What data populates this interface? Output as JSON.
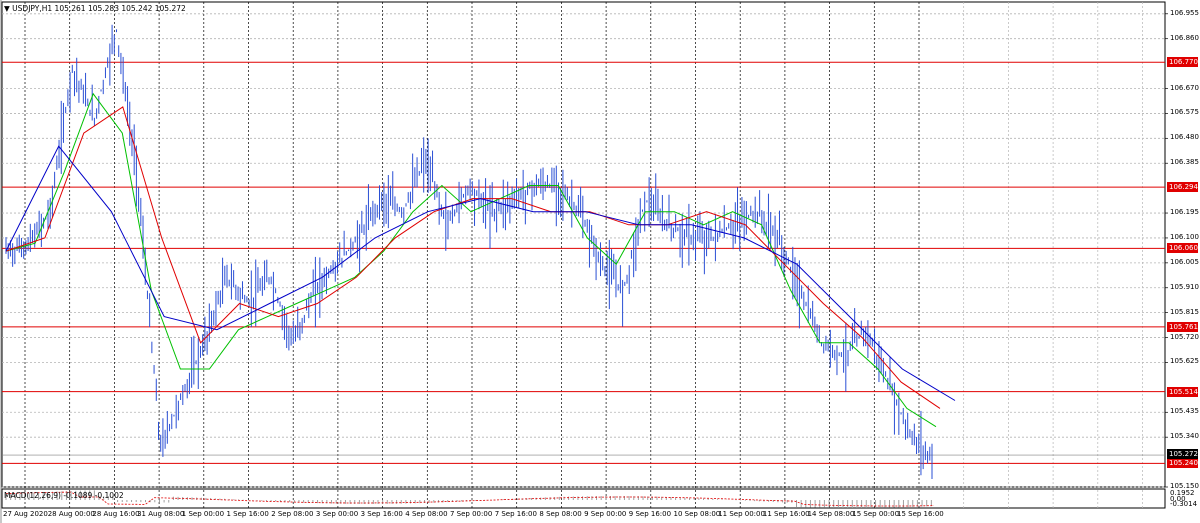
{
  "symbol_line": {
    "marker": "▼",
    "symbol": "USDJPY,H1",
    "ohlc": "105.261 105.283 105.242 105.272"
  },
  "price_axis": {
    "min": 105.15,
    "max": 107.0,
    "ticks": [
      "106.955",
      "106.860",
      "106.670",
      "106.575",
      "106.480",
      "106.385",
      "106.195",
      "106.100",
      "106.005",
      "105.910",
      "105.815",
      "105.720",
      "105.625",
      "105.435",
      "105.340",
      "105.150"
    ],
    "tick_values": [
      106.955,
      106.86,
      106.67,
      106.575,
      106.48,
      106.385,
      106.195,
      106.1,
      106.005,
      105.91,
      105.815,
      105.72,
      105.625,
      105.435,
      105.34,
      105.15
    ]
  },
  "levels": [
    {
      "label": "106.770",
      "value": 106.77
    },
    {
      "label": "106.294",
      "value": 106.294
    },
    {
      "label": "106.060",
      "value": 106.06
    },
    {
      "label": "105.761",
      "value": 105.761
    },
    {
      "label": "105.514",
      "value": 105.514
    },
    {
      "label": "105.240",
      "value": 105.24
    }
  ],
  "current_price": {
    "label": "105.272",
    "value": 105.272
  },
  "macd": {
    "label": "MACD(12,26,9) -0.1089 -0.1002",
    "axis_ticks": [
      "0.1952",
      "0.00",
      "-0.3014"
    ]
  },
  "time_axis": {
    "labels": [
      "27 Aug 2020",
      "28 Aug 00:00",
      "28 Aug 16:00",
      "31 Aug 08:00",
      "1 Sep 00:00",
      "1 Sep 16:00",
      "2 Sep 08:00",
      "3 Sep 00:00",
      "3 Sep 16:00",
      "4 Sep 08:00",
      "7 Sep 00:00",
      "7 Sep 16:00",
      "8 Sep 08:00",
      "9 Sep 00:00",
      "9 Sep 16:00",
      "10 Sep 08:00",
      "11 Sep 00:00",
      "11 Sep 16:00",
      "14 Sep 08:00",
      "15 Sep 00:00",
      "15 Sep 16:00"
    ]
  },
  "chart_data": {
    "type": "line",
    "series": [
      {
        "name": "",
        "color": "#2a4fd4",
        "values": [
          106.05,
          106.07,
          106.2,
          106.75,
          106.55,
          106.9,
          106.3,
          105.3,
          105.5,
          105.7,
          105.95,
          105.85,
          105.95,
          105.7,
          105.9,
          106.0,
          106.1,
          106.25,
          106.2,
          106.4,
          106.15,
          106.3,
          106.2,
          106.25,
          106.3,
          106.3,
          106.2,
          106.0,
          105.9,
          106.25,
          106.15,
          106.1,
          106.1,
          106.15,
          106.2,
          106.1,
          105.9,
          105.7,
          105.65,
          105.75,
          105.55,
          105.35,
          105.26
        ]
      },
      {
        "name": "",
        "color": "#00c000",
        "values": [
          106.05,
          106.08,
          106.35,
          106.65,
          106.5,
          105.9,
          105.6,
          105.6,
          105.75,
          105.8,
          105.85,
          105.9,
          105.95,
          106.05,
          106.2,
          106.3,
          106.2,
          106.25,
          106.3,
          106.3,
          106.1,
          106.0,
          106.2,
          106.2,
          106.15,
          106.2,
          106.15,
          105.9,
          105.7,
          105.7,
          105.6,
          105.45,
          105.38
        ]
      },
      {
        "name": "",
        "color": "#e00000",
        "values": [
          106.05,
          106.1,
          106.5,
          106.6,
          106.1,
          105.7,
          105.85,
          105.8,
          105.85,
          105.95,
          106.1,
          106.2,
          106.25,
          106.25,
          106.2,
          106.2,
          106.15,
          106.15,
          106.2,
          106.15,
          106.0,
          105.85,
          105.72,
          105.55,
          105.45
        ]
      },
      {
        "name": "",
        "color": "#0000c8",
        "values": [
          106.05,
          106.45,
          106.2,
          105.8,
          105.75,
          105.85,
          105.95,
          106.1,
          106.2,
          106.25,
          106.2,
          106.2,
          106.15,
          106.15,
          106.1,
          106.0,
          105.8,
          105.6,
          105.48
        ]
      }
    ]
  }
}
